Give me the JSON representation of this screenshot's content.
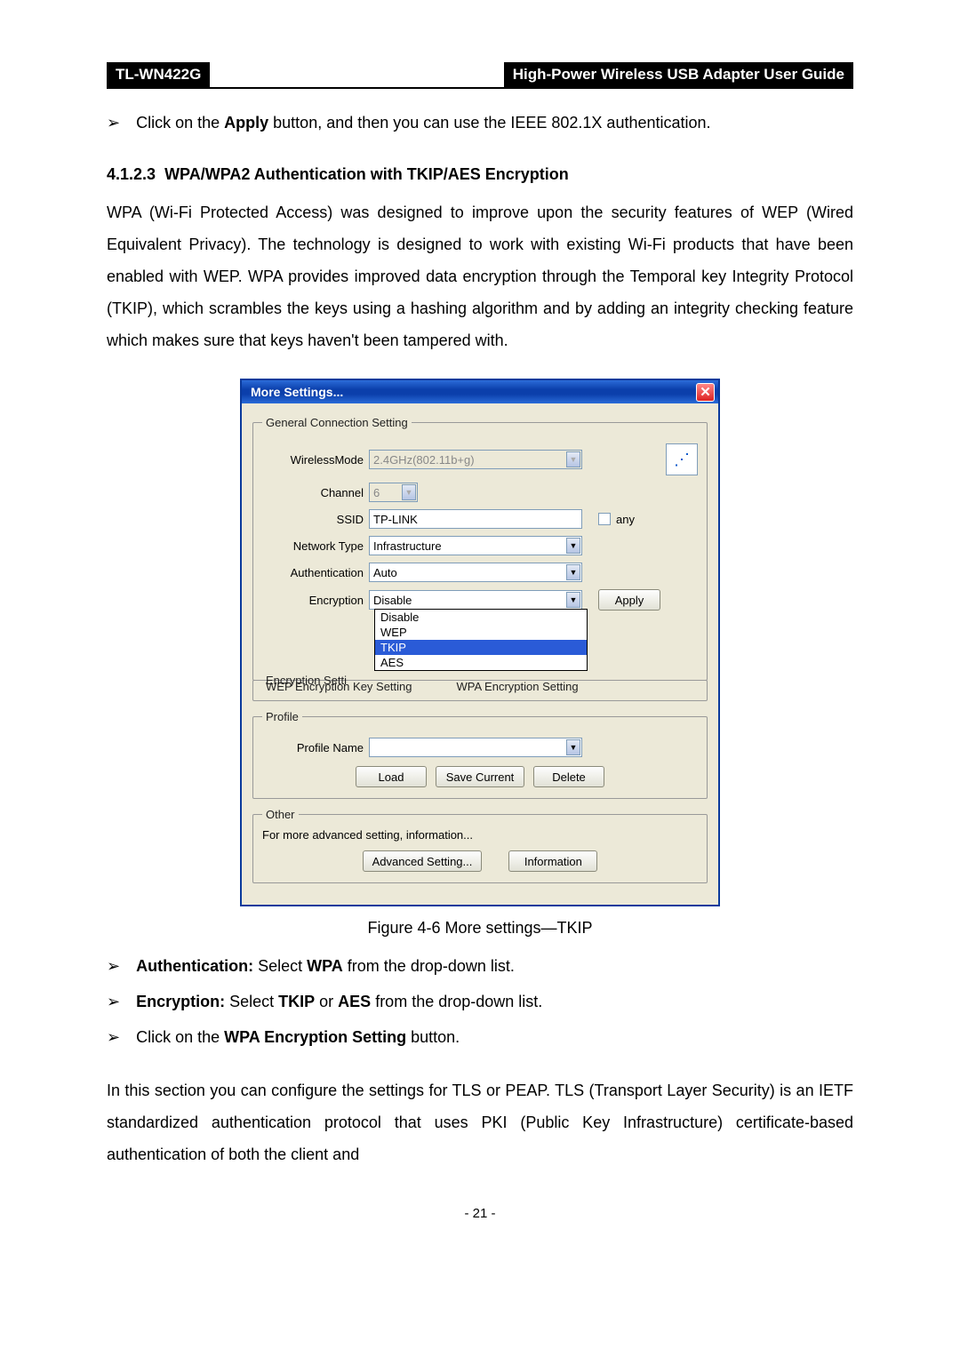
{
  "header": {
    "model": "TL-WN422G",
    "guide": "High-Power Wireless USB Adapter User Guide"
  },
  "intro_bullet": {
    "prefix": "Click on the ",
    "bold1": "Apply",
    "suffix": " button, and then you can use the IEEE 802.1X authentication."
  },
  "section": {
    "number": "4.1.2.3",
    "title": "WPA/WPA2 Authentication with TKIP/AES Encryption"
  },
  "para1": "WPA (Wi-Fi Protected Access) was designed to improve upon the security features of WEP (Wired Equivalent Privacy). The technology is designed to work with existing Wi-Fi products that have been enabled with WEP. WPA provides improved data encryption through the Temporal key Integrity Protocol (TKIP), which scrambles the keys using a hashing algorithm and by adding an integrity checking feature which makes sure that keys haven't been tampered with.",
  "dialog": {
    "title": "More Settings...",
    "close": "✕",
    "groups": {
      "general": {
        "legend": "General Connection Setting",
        "wirelessMode": {
          "label": "WirelessMode",
          "value": "2.4GHz(802.11b+g)"
        },
        "channel": {
          "label": "Channel",
          "value": "6"
        },
        "ssid": {
          "label": "SSID",
          "value": "TP-LINK",
          "any": "any"
        },
        "networkType": {
          "label": "Network Type",
          "value": "Infrastructure"
        },
        "authentication": {
          "label": "Authentication",
          "value": "Auto"
        },
        "encryption": {
          "label": "Encryption",
          "value": "Disable",
          "options": [
            "Disable",
            "WEP",
            "TKIP",
            "AES"
          ],
          "selected": "TKIP"
        },
        "apply": "Apply"
      },
      "encSetting": {
        "legend": "Encryption Setti",
        "tab1": "WEP Encryption Key Setting",
        "tab2": "WPA Encryption Setting"
      },
      "profile": {
        "legend": "Profile",
        "nameLabel": "Profile Name",
        "nameValue": "",
        "load": "Load",
        "saveCurrent": "Save Current",
        "delete": "Delete"
      },
      "other": {
        "legend": "Other",
        "text": "For more advanced setting, information...",
        "advanced": "Advanced Setting...",
        "information": "Information"
      }
    }
  },
  "caption": "Figure 4-6 More settings—TKIP",
  "bullets2": [
    {
      "boldPrefix": "Authentication:",
      "mid": " Select ",
      "bold2": "WPA",
      "suffix": " from the drop-down list."
    },
    {
      "boldPrefix": "Encryption:",
      "mid": " Select ",
      "bold2": "TKIP",
      "mid2": " or ",
      "bold3": "AES",
      "suffix": " from the drop-down list."
    }
  ],
  "bullet3": {
    "prefix": "Click on the ",
    "bold1": "WPA Encryption Setting",
    "suffix": " button."
  },
  "para2": "In this section you can configure the settings for TLS or PEAP. TLS (Transport Layer Security) is an IETF standardized authentication protocol that uses PKI (Public Key Infrastructure) certificate-based authentication of both the client and",
  "pageNum": "- 21 -"
}
